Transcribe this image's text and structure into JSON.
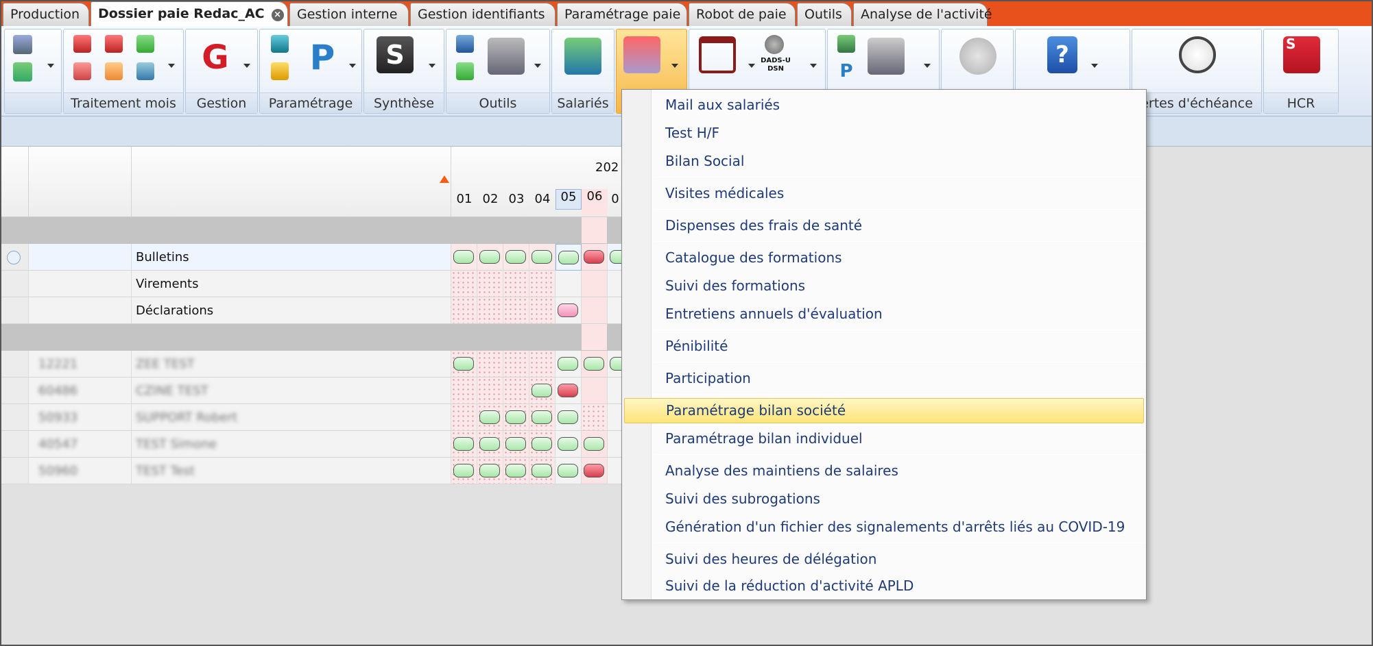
{
  "tabs": [
    {
      "label": "Production"
    },
    {
      "label": "Dossier paie Redac_AC",
      "active": true,
      "close": "×"
    },
    {
      "label": "Gestion interne"
    },
    {
      "label": "Gestion identifiants"
    },
    {
      "label": "Paramétrage paie"
    },
    {
      "label": "Robot de paie"
    },
    {
      "label": "Outils"
    },
    {
      "label": "Analyse de l'activité"
    }
  ],
  "ribbon": {
    "groups": {
      "traitement_mois": "Traitement mois",
      "gestion": "Gestion",
      "parametrage": "Paramétrage",
      "synthese": "Synthèse",
      "outils": "Outils",
      "salaries": "Salariés",
      "alertes": "ertes d'échéance",
      "hcr": "HCR"
    },
    "icon_text": {
      "gestion": "G",
      "parametrage": "P",
      "synthese": "S",
      "dads": "DADS-U",
      "dsn": "DSN",
      "help": "?",
      "hcr": "S"
    }
  },
  "grid": {
    "year": "202",
    "months": [
      "01",
      "02",
      "03",
      "04",
      "05",
      "06",
      "0"
    ],
    "rows": {
      "bulletins": "Bulletins",
      "virements": "Virements",
      "declarations": "Déclarations"
    },
    "employees": [
      {
        "code": "12221",
        "name": "ZEE TEST"
      },
      {
        "code": "60486",
        "name": "CZINE TEST"
      },
      {
        "code": "50933",
        "name": "SUPPORT Robert"
      },
      {
        "code": "40547",
        "name": "TEST Simone"
      },
      {
        "code": "50960",
        "name": "TEST Test"
      }
    ]
  },
  "menu": {
    "items": [
      "Mail aux salariés",
      "Test H/F",
      "Bilan Social",
      "Visites médicales",
      "Dispenses des frais de santé",
      "Catalogue des formations",
      "Suivi des formations",
      "Entretiens annuels d'évaluation",
      "Pénibilité",
      "Participation",
      "Paramétrage bilan société",
      "Paramétrage bilan individuel",
      "Analyse des maintiens de salaires",
      "Suivi des subrogations",
      "Génération d'un fichier des signalements d'arrêts liés au COVID-19",
      "Suivi des heures de délégation",
      "Suivi de la réduction d'activité APLD"
    ],
    "highlighted_index": 10
  },
  "colors": {
    "tabstrip": "#e9511c",
    "menu_text": "#1f3a78",
    "highlight": "#fee479",
    "pill_green": "#a8e6a8",
    "pill_red": "#d4404f"
  }
}
